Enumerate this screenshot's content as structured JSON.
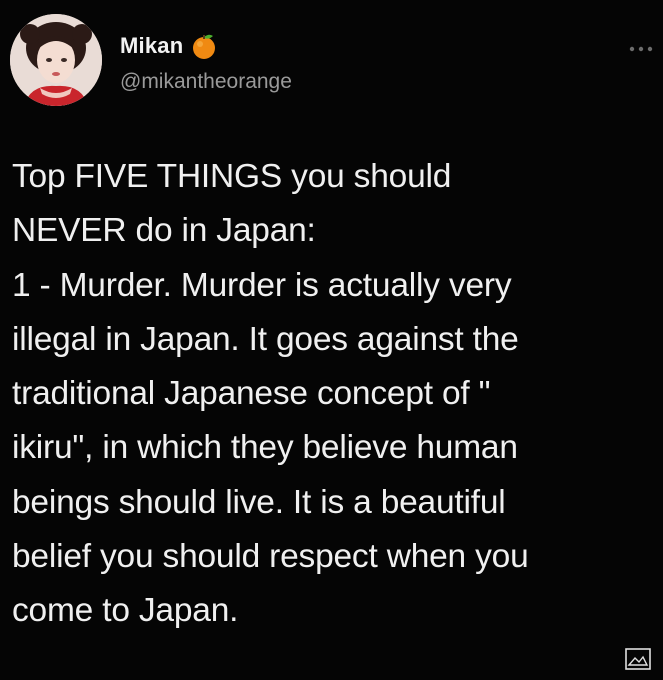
{
  "tweet": {
    "author": {
      "display_name": "Mikan",
      "name_emoji": "orange-emoji",
      "handle": "@mikantheorange",
      "avatar": "profile-photo"
    },
    "more_icon": "ellipsis-icon",
    "lines": [
      "Top FIVE THINGS you should",
      "NEVER do in Japan:",
      "1 - Murder. Murder is actually very",
      "illegal in Japan. It goes against the",
      "traditional Japanese concept of \"",
      "ikiru\", in which they believe human",
      "beings should live. It is a beautiful",
      "belief you should respect when you",
      "come to Japan."
    ],
    "media_icon": "image-icon"
  },
  "colors": {
    "background": "#050505",
    "text": "#f0f0f0",
    "handle": "#9a9a9a",
    "orange": "#f08a12"
  }
}
